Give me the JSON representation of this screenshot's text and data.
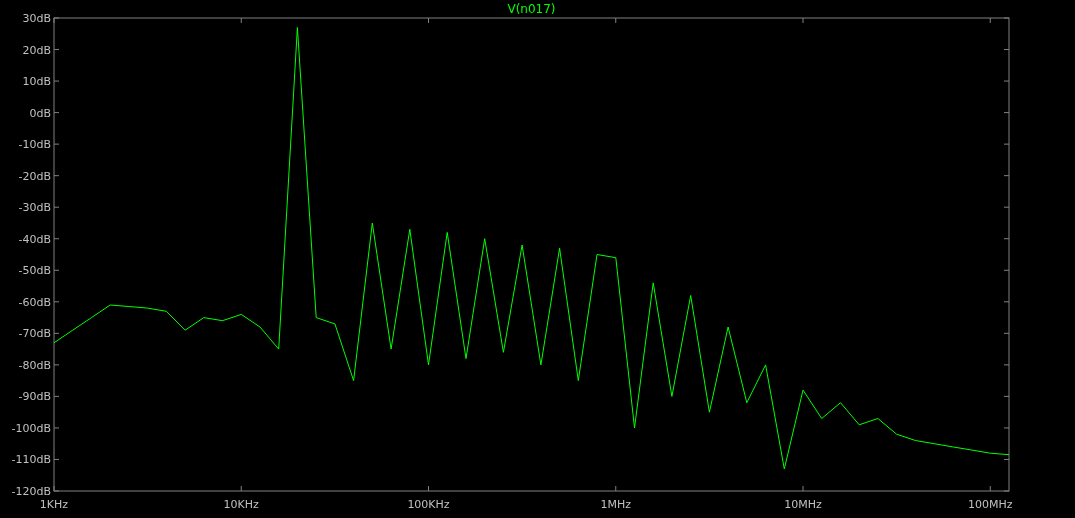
{
  "chart_data": {
    "type": "line",
    "ylim": [
      -120,
      30
    ],
    "yticks": [
      {
        "value": 30,
        "label": "30dB"
      },
      {
        "value": 20,
        "label": "20dB"
      },
      {
        "value": 10,
        "label": "10dB"
      },
      {
        "value": 0,
        "label": "0dB"
      },
      {
        "value": -10,
        "label": "-10dB"
      },
      {
        "value": -20,
        "label": "-20dB"
      },
      {
        "value": -30,
        "label": "-30dB"
      },
      {
        "value": -40,
        "label": "-40dB"
      },
      {
        "value": -50,
        "label": "-50dB"
      },
      {
        "value": -60,
        "label": "-60dB"
      },
      {
        "value": -70,
        "label": "-70dB"
      },
      {
        "value": -80,
        "label": "-80dB"
      },
      {
        "value": -90,
        "label": "-90dB"
      },
      {
        "value": -100,
        "label": "-100dB"
      },
      {
        "value": -110,
        "label": "-110dB"
      },
      {
        "value": -120,
        "label": "-120dB"
      }
    ],
    "categories": [
      "1KHz",
      null,
      null,
      null,
      null,
      null,
      null,
      null,
      null,
      null,
      "10KHz",
      null,
      null,
      null,
      null,
      null,
      null,
      null,
      null,
      null,
      "100KHz",
      null,
      null,
      null,
      null,
      null,
      null,
      null,
      null,
      null,
      "1MHz",
      null,
      null,
      null,
      null,
      null,
      null,
      null,
      null,
      null,
      "10MHz",
      null,
      null,
      null,
      null,
      null,
      null,
      null,
      null,
      null,
      "100MHz",
      null
    ],
    "series": [
      {
        "name": "V(n017)",
        "color": "#00ff00",
        "values": [
          -73,
          -69,
          -65,
          -61,
          -61.5,
          -62,
          -63,
          -69,
          -65,
          -66,
          -64,
          -68,
          -75,
          27,
          -65,
          -67,
          -85,
          -35,
          -75,
          -37,
          -80,
          -38,
          -78,
          -40,
          -76,
          -42,
          -80,
          -43,
          -85,
          -45,
          -46,
          -100,
          -54,
          -90,
          -58,
          -95,
          -68,
          -92,
          -80,
          -113,
          -88,
          -97,
          -92,
          -99,
          -97,
          -102,
          -104,
          -105,
          -106,
          -107,
          -108,
          -108.5
        ]
      }
    ]
  }
}
